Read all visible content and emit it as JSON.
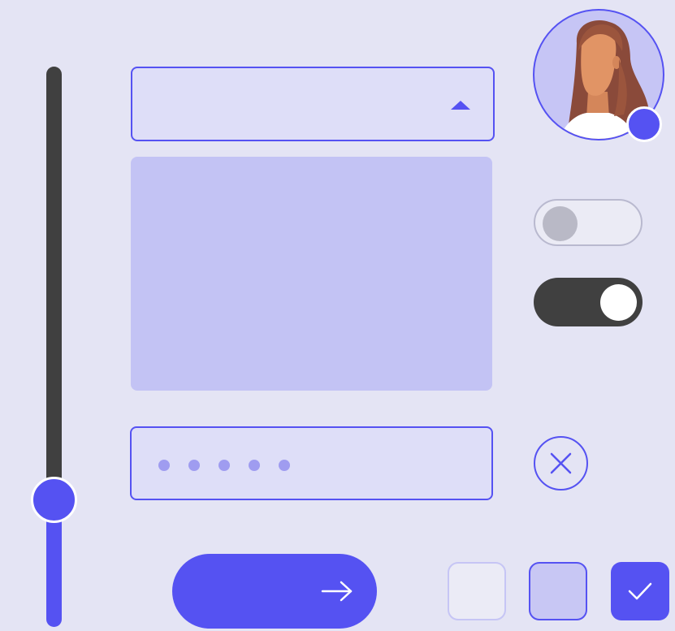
{
  "colors": {
    "accent": "#5552f2",
    "dark": "#404040",
    "background": "#e4e4f4",
    "field_fill": "#dedef8",
    "panel_fill": "#c3c3f4"
  },
  "slider": {
    "value_fraction": 0.21,
    "orientation": "vertical"
  },
  "dropdown": {
    "value": "",
    "icon": "caret-up-icon"
  },
  "textarea": {
    "value": ""
  },
  "password": {
    "masked_char_count": 5
  },
  "avatar": {
    "status": "online"
  },
  "toggles": [
    {
      "state": "off"
    },
    {
      "state": "on"
    }
  ],
  "clear_button": {
    "icon": "close-icon"
  },
  "submit_button": {
    "label": "",
    "icon": "arrow-right-icon"
  },
  "checkboxes": [
    {
      "state": "unchecked"
    },
    {
      "state": "indeterminate"
    },
    {
      "state": "checked",
      "icon": "check-icon"
    }
  ]
}
